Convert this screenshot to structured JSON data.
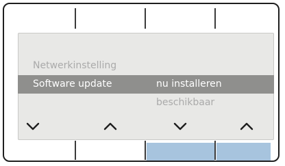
{
  "menu": {
    "items": [
      {
        "label": "Netwerkinstelling",
        "value": ""
      },
      {
        "label": "Software update",
        "value": "nu installeren"
      },
      {
        "label": "",
        "value": "beschikbaar"
      }
    ]
  },
  "softkeys": [
    {
      "icon": "chevron-down-icon"
    },
    {
      "icon": "chevron-up-icon"
    },
    {
      "icon": "chevron-down-icon"
    },
    {
      "icon": "chevron-up-icon"
    }
  ],
  "colors": {
    "highlight": "#8f8f8d",
    "screen": "#e8e8e6",
    "tab_active": "#a7c4de"
  }
}
